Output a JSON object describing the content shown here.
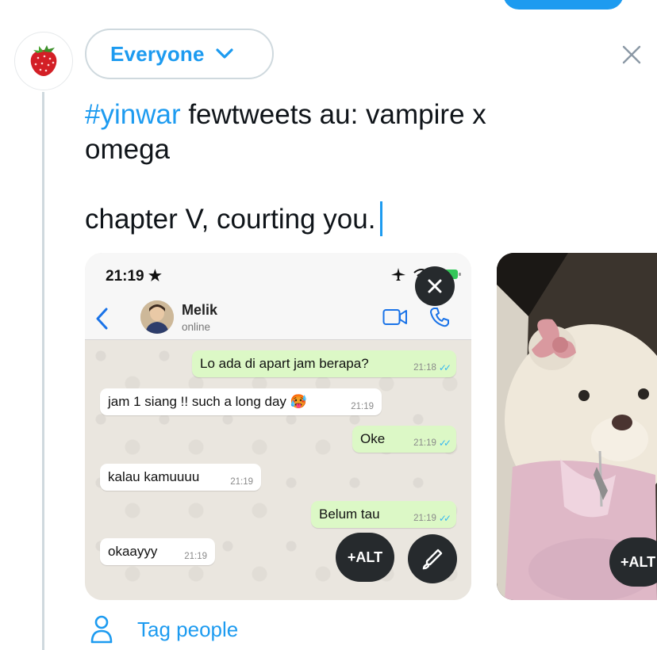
{
  "audience": {
    "label": "Everyone"
  },
  "tweet": {
    "hashtag": "#yinwar",
    "line1_rest": " fewtweets au: vampire x",
    "line2": "omega",
    "line3": "chapter V, courting you."
  },
  "media": [
    {
      "status_time": "21:19",
      "contact": {
        "name": "Melik",
        "status": "online"
      },
      "messages": [
        {
          "dir": "out",
          "text": "Lo ada di apart jam berapa?",
          "time": "21:18"
        },
        {
          "dir": "in",
          "text": "jam 1 siang !! such a long day 🥵",
          "time": "21:19"
        },
        {
          "dir": "out",
          "text": "Oke",
          "time": "21:19"
        },
        {
          "dir": "in",
          "text": "kalau kamuuuu",
          "time": "21:19"
        },
        {
          "dir": "out",
          "text": "Belum tau",
          "time": "21:19"
        },
        {
          "dir": "in",
          "text": "okaayyy",
          "time": "21:19"
        }
      ],
      "alt_label": "+ALT"
    },
    {
      "alt_label": "+ALT"
    }
  ],
  "tag_people": {
    "label": "Tag people"
  },
  "colors": {
    "accent": "#1d9bf0",
    "outgoing_bubble": "#dcf8c6",
    "media_button": "#262a2d"
  },
  "icons": [
    "strawberry-avatar",
    "chevron-down-icon",
    "close-icon",
    "back-arrow-icon",
    "video-call-icon",
    "phone-icon",
    "remove-media-icon",
    "edit-media-icon",
    "person-icon"
  ]
}
